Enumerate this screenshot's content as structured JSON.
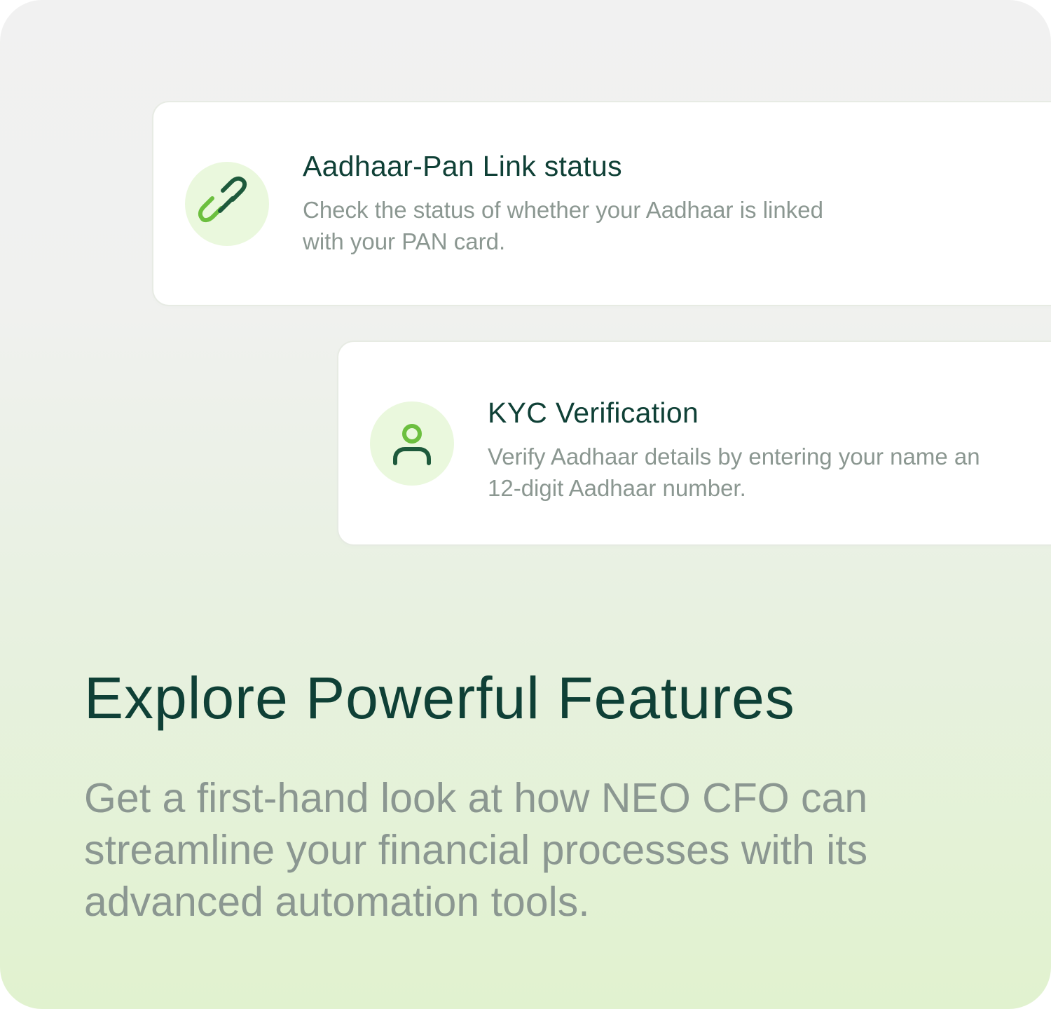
{
  "cards": [
    {
      "title": "Aadhaar-Pan Link status",
      "description": [
        "Check the status of whether your Aadhaar is linked",
        "with your PAN card."
      ],
      "icon": "link-icon"
    },
    {
      "title": "KYC Verification",
      "description": [
        "Verify Aadhaar details by entering your name an",
        "12-digit Aadhaar number."
      ],
      "icon": "user-icon"
    }
  ],
  "hero": {
    "title": "Explore Powerful Features",
    "subtitle": [
      "Get a first-hand look at how NEO CFO can",
      "streamline your financial processes with its",
      "advanced automation tools."
    ]
  },
  "colors": {
    "title_text": "#0f4036",
    "muted_text": "#8b9791",
    "icon_dark": "#1e5a3c",
    "icon_accent": "#6cbf3f",
    "icon_bg": "#eaf8dd"
  }
}
